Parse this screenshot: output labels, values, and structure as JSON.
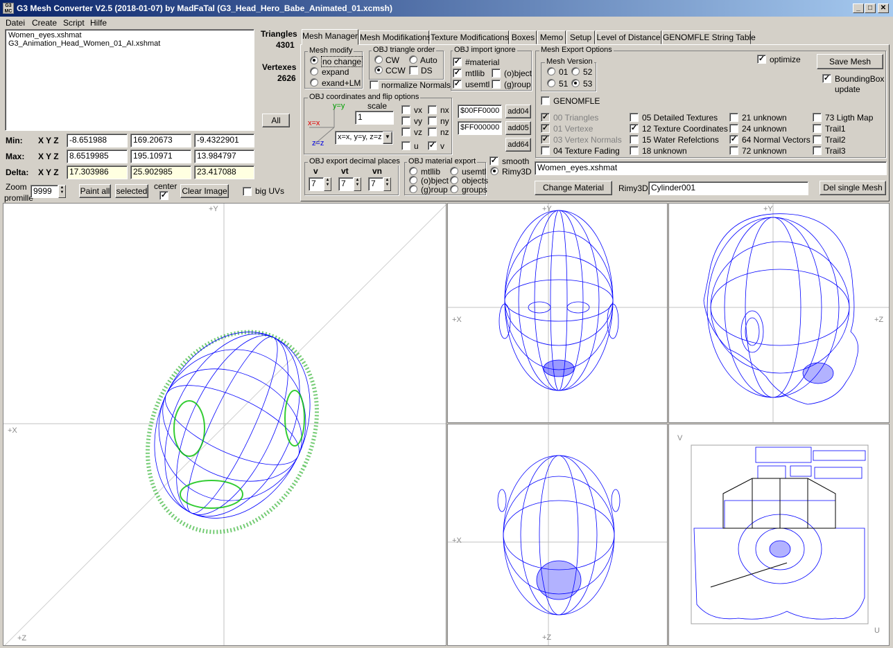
{
  "window": {
    "title": "G3 Mesh Converter V2.5 (2018-01-07) by MadFaTal (G3_Head_Hero_Babe_Animated_01.xcmsh)",
    "icon_text": "G3 MC",
    "min_glyph": "_",
    "max_glyph": "□",
    "close_glyph": "✕"
  },
  "menu": [
    "Datei",
    "Create",
    "Script",
    "Hilfe"
  ],
  "files": [
    "Women_eyes.xshmat",
    "G3_Animation_Head_Women_01_AI.xshmat"
  ],
  "stats": {
    "triangles_label": "Triangles",
    "triangles": "4301",
    "vertexes_label": "Vertexes",
    "vertexes": "2626",
    "all_label": "All"
  },
  "bounds": {
    "xyz": "X Y Z",
    "min": {
      "label": "Min:",
      "x": "-8.651988",
      "y": "169.20673",
      "z": "-9.4322901"
    },
    "max": {
      "label": "Max:",
      "x": "8.6519985",
      "y": "195.10971",
      "z": "13.984797"
    },
    "delta": {
      "label": "Delta:",
      "x": "17.303986",
      "y": "25.902985",
      "z": "23.417088"
    }
  },
  "bottom": {
    "zoom_label": "Zoom",
    "promille_label": "promille",
    "zoom_value": "9999",
    "paint_all": "Paint all",
    "selected": "selected",
    "center": "center",
    "clear_image": "Clear Image",
    "big_uvs": "big UVs"
  },
  "tabs": [
    "Mesh Manager",
    "Mesh Modifikations",
    "Texture Modifications",
    "Boxes",
    "Memo",
    "Setup",
    "Level of Distance",
    "GENOMFLE String Table"
  ],
  "mesh_modify": {
    "title": "Mesh modify",
    "options": [
      "no change",
      "expand",
      "exand+LM"
    ]
  },
  "triangle_order": {
    "title": "OBJ triangle order",
    "cw": "CW",
    "auto": "Auto",
    "ccw": "CCW",
    "ds": "DS",
    "normalize": "normalize Normals"
  },
  "import_ignore": {
    "title": "OBJ import ignore",
    "material": "#material",
    "mtllib": "mtllib",
    "object": "(o)bject",
    "usemtl": "usemtl",
    "group": "(g)roup"
  },
  "coords": {
    "title": "OBJ coordinates and flip options",
    "scale_label": "scale",
    "scale_value": "1",
    "yy": "y=y",
    "xx": "x=x",
    "zz": "z=z",
    "mapping": "x=x, y=y, z=z",
    "vx": "vx",
    "vy": "vy",
    "vz": "vz",
    "u": "u",
    "nx": "nx",
    "ny": "ny",
    "nz": "nz",
    "v": "v"
  },
  "colors": {
    "c1": "$00FF0000",
    "c2": "$FF000000",
    "add04": "add04",
    "add05": "add05",
    "add64": "add64"
  },
  "decimals": {
    "title": "OBJ export decimal places",
    "v": "v",
    "vt": "vt",
    "vn": "vn",
    "v_val": "7",
    "vt_val": "7",
    "vn_val": "7"
  },
  "material_export": {
    "title": "OBJ material export",
    "mtllib": "mtllib",
    "usemtl": "usemtl",
    "object": "(o)bject",
    "objects": "objects",
    "group": "(g)roup",
    "groups": "groups"
  },
  "smooth": {
    "smooth": "smooth",
    "rimy": "Rimy3D"
  },
  "export_options": {
    "title": "Mesh Export Options",
    "version_title": "Mesh Version",
    "versions": [
      "01",
      "52",
      "51",
      "53"
    ],
    "optimize": "optimize",
    "save_mesh": "Save Mesh",
    "bbox": "BoundingBox",
    "bbox2": "update",
    "genomfle": "GENOMFLE",
    "col1": [
      "00 Triangles",
      "01 Vertexe",
      "03 Vertex Normals",
      "04 Texture Fading"
    ],
    "col2": [
      "05 Detailed Textures",
      "12 Texture Coordinates",
      "15 Water Refelctions",
      "18 unknown"
    ],
    "col3": [
      "21 unknown",
      "24 unknown",
      "64 Normal Vectors",
      "72 unknown"
    ],
    "col4": [
      "73 Ligth Map",
      "Trail1",
      "Trail2",
      "Trail3"
    ]
  },
  "material_name": "Women_eyes.xshmat",
  "change_material": "Change Material",
  "rimy3d_label": "Rimy3D:",
  "rimy3d_value": "Cylinder001",
  "del_single": "Del single Mesh",
  "viewports": {
    "py": "+Y",
    "px": "+X",
    "pz": "+Z",
    "v": "V",
    "u": "U"
  },
  "colors_ui": {
    "wire": "#0000ff",
    "normals": "#00c000",
    "title_start": "#0a246a",
    "title_end": "#a6caf0"
  }
}
